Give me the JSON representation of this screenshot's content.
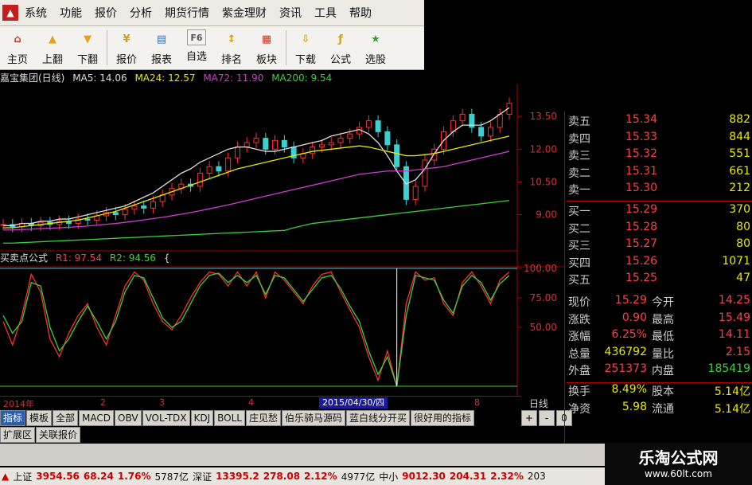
{
  "menu": {
    "items": [
      "系统",
      "功能",
      "报价",
      "分析",
      "期货行情",
      "紫金理财",
      "资讯",
      "工具",
      "帮助"
    ]
  },
  "toolbar": {
    "buttons": [
      {
        "label": "主页",
        "icon": "home-icon",
        "color": "#c0392b"
      },
      {
        "label": "上翻",
        "icon": "arrow-up-icon",
        "color": "#e8a21a"
      },
      {
        "label": "下翻",
        "icon": "arrow-down-icon",
        "color": "#e8a21a"
      },
      {
        "label": "报价",
        "icon": "yen-icon",
        "color": "#d4a017"
      },
      {
        "label": "报表",
        "icon": "report-icon",
        "color": "#3a6fb0"
      },
      {
        "label": "自选",
        "icon": "f6-icon",
        "color": "#7a7a7a"
      },
      {
        "label": "排名",
        "icon": "ranking-icon",
        "color": "#d4a017"
      },
      {
        "label": "板块",
        "icon": "blocks-icon",
        "color": "#c0392b"
      },
      {
        "label": "下载",
        "icon": "download-icon",
        "color": "#e8a21a"
      },
      {
        "label": "公式",
        "icon": "formula-icon",
        "color": "#d4a017"
      },
      {
        "label": "选股",
        "icon": "stock-picker-icon",
        "color": "#3a9a3a"
      }
    ]
  },
  "chart_header": {
    "title": "嘉宝集团(日线)",
    "ma5": "MA5: 14.06",
    "ma24": "MA24: 12.57",
    "ma72": "MA72: 11.90",
    "ma200": "MA200: 9.54"
  },
  "indicator_header": {
    "title": "买卖点公式",
    "r1": "R1: 97.54",
    "r2": "R2: 94.56",
    "cursor": "{"
  },
  "axis": {
    "price_ticks": [
      "13.50",
      "12.00",
      "10.50",
      "9.00"
    ],
    "indicator_ticks": [
      "100.00",
      "75.00",
      "50.00"
    ],
    "time_labels": [
      "2014年",
      "2",
      "3",
      "4",
      "8"
    ],
    "cursor_date": "2015/04/30/四",
    "chart_type": "日线"
  },
  "tabs": {
    "row1": [
      "指标",
      "模板",
      "全部",
      "MACD",
      "OBV",
      "VOL-TDX",
      "KDJ",
      "BOLL",
      "庄见愁",
      "伯乐骑马源码",
      "蓝白线分开买",
      "很好用的指标"
    ],
    "row2": [
      "扩展区",
      "关联报价"
    ],
    "nav": [
      "+",
      "-",
      "0"
    ]
  },
  "order_book": {
    "sell": [
      {
        "label": "卖五",
        "price": "15.34",
        "vol": "882"
      },
      {
        "label": "卖四",
        "price": "15.33",
        "vol": "844"
      },
      {
        "label": "卖三",
        "price": "15.32",
        "vol": "551"
      },
      {
        "label": "卖二",
        "price": "15.31",
        "vol": "661"
      },
      {
        "label": "卖一",
        "price": "15.30",
        "vol": "212"
      }
    ],
    "buy": [
      {
        "label": "买一",
        "price": "15.29",
        "vol": "370"
      },
      {
        "label": "买二",
        "price": "15.28",
        "vol": "80"
      },
      {
        "label": "买三",
        "price": "15.27",
        "vol": "80"
      },
      {
        "label": "买四",
        "price": "15.26",
        "vol": "1071"
      },
      {
        "label": "买五",
        "price": "15.25",
        "vol": "47"
      }
    ]
  },
  "stats": [
    {
      "l1": "现价",
      "v1": "15.29",
      "c1": "#ff4040",
      "l2": "今开",
      "v2": "14.25",
      "c2": "#ff4040"
    },
    {
      "l1": "涨跌",
      "v1": "0.90",
      "c1": "#ff4040",
      "l2": "最高",
      "v2": "15.49",
      "c2": "#ff4040"
    },
    {
      "l1": "涨幅",
      "v1": "6.25%",
      "c1": "#ff4040",
      "l2": "最低",
      "v2": "14.11",
      "c2": "#ff4040"
    },
    {
      "l1": "总量",
      "v1": "436792",
      "c1": "#e8e800",
      "l2": "量比",
      "v2": "2.15",
      "c2": "#ff4040"
    },
    {
      "l1": "外盘",
      "v1": "251373",
      "c1": "#ff4040",
      "l2": "内盘",
      "v2": "185419",
      "c2": "#3ad13a"
    }
  ],
  "stats2": [
    {
      "l1": "换手",
      "v1": "8.49%",
      "c1": "#e8e800",
      "l2": "股本",
      "v2": "5.14亿",
      "c2": "#e8e800"
    },
    {
      "l1": "净资",
      "v1": "5.98",
      "c1": "#e8e800",
      "l2": "流通",
      "v2": "5.14亿",
      "c2": "#e8e800"
    }
  ],
  "statusbar": {
    "sh_label": "上证",
    "sh_value": "3954.56",
    "sh_change": "68.24",
    "sh_pct": "1.76%",
    "sh_amount": "5787亿",
    "sz_label": "深证",
    "sz_value": "13395.2",
    "sz_change": "278.08",
    "sz_pct": "2.12%",
    "sz_amount": "4977亿",
    "zx_label": "中小",
    "zx_value": "9012.30",
    "zx_change": "204.31",
    "zx_pct": "2.32%",
    "zx_amount": "203"
  },
  "watermark": {
    "title": "乐淘公式网",
    "url": "www.60lt.com"
  },
  "chart_data": [
    {
      "type": "candlestick",
      "title": "嘉宝集团(日线)",
      "ylim": [
        8.0,
        14.2
      ],
      "y_ticks": [
        13.5,
        12.0,
        10.5,
        9.0
      ],
      "close": [
        8.55,
        8.45,
        8.6,
        8.5,
        8.65,
        8.55,
        8.7,
        8.6,
        8.8,
        8.75,
        8.95,
        9.1,
        9.0,
        9.25,
        9.4,
        9.3,
        9.6,
        9.9,
        10.2,
        10.4,
        10.3,
        10.9,
        11.2,
        11.0,
        11.6,
        12.1,
        12.3,
        12.5,
        12.0,
        12.4,
        12.1,
        11.6,
        11.8,
        12.1,
        12.2,
        12.3,
        12.5,
        12.7,
        13.0,
        13.3,
        12.8,
        12.2,
        11.2,
        9.7,
        10.3,
        11.5,
        12.0,
        12.8,
        13.3,
        13.6,
        13.0,
        12.6,
        13.0,
        13.6,
        14.1
      ],
      "series": [
        {
          "name": "MA5",
          "values": [
            8.5,
            8.5,
            8.6,
            8.6,
            8.7,
            8.7,
            8.8,
            8.8,
            8.9,
            9.0,
            9.1,
            9.2,
            9.3,
            9.4,
            9.6,
            9.8,
            10.0,
            10.3,
            10.6,
            10.9,
            11.1,
            11.4,
            11.6,
            11.8,
            12.0,
            12.1,
            12.1,
            12.0,
            11.9,
            11.9,
            12.0,
            12.1,
            12.2,
            12.3,
            12.4,
            12.6,
            12.7,
            12.8,
            12.9,
            12.7,
            12.3,
            11.7,
            11.0,
            10.4,
            10.6,
            11.1,
            11.8,
            12.4,
            12.8,
            13.1,
            13.1,
            13.1,
            13.3,
            13.6,
            13.9
          ]
        },
        {
          "name": "MA24",
          "values": [
            8.4,
            8.4,
            8.45,
            8.5,
            8.55,
            8.6,
            8.65,
            8.7,
            8.75,
            8.85,
            8.95,
            9.05,
            9.15,
            9.3,
            9.45,
            9.6,
            9.75,
            9.9,
            10.05,
            10.2,
            10.35,
            10.5,
            10.65,
            10.8,
            10.95,
            11.1,
            11.2,
            11.3,
            11.4,
            11.5,
            11.6,
            11.7,
            11.8,
            11.9,
            11.95,
            12.0,
            12.05,
            12.1,
            12.15,
            12.1,
            12.0,
            11.9,
            11.8,
            11.7,
            11.7,
            11.75,
            11.8,
            11.9,
            12.0,
            12.1,
            12.2,
            12.3,
            12.4,
            12.5,
            12.6
          ]
        },
        {
          "name": "MA72",
          "values": [
            8.3,
            8.3,
            8.32,
            8.34,
            8.36,
            8.38,
            8.4,
            8.42,
            8.45,
            8.48,
            8.52,
            8.56,
            8.6,
            8.65,
            8.7,
            8.76,
            8.82,
            8.88,
            8.95,
            9.02,
            9.1,
            9.18,
            9.27,
            9.36,
            9.45,
            9.55,
            9.65,
            9.75,
            9.85,
            9.95,
            10.05,
            10.15,
            10.25,
            10.35,
            10.45,
            10.55,
            10.65,
            10.75,
            10.85,
            10.9,
            10.95,
            11.0,
            11.0,
            11.0,
            11.05,
            11.1,
            11.15,
            11.2,
            11.3,
            11.4,
            11.5,
            11.6,
            11.7,
            11.8,
            11.9
          ]
        },
        {
          "name": "MA200",
          "values": [
            7.7,
            7.7,
            7.72,
            7.74,
            7.76,
            7.78,
            7.8,
            7.82,
            7.84,
            7.86,
            7.88,
            7.9,
            7.92,
            7.94,
            7.96,
            7.98,
            8.0,
            8.02,
            8.04,
            8.06,
            8.08,
            8.1,
            8.12,
            8.14,
            8.16,
            8.18,
            8.2,
            8.22,
            8.24,
            8.26,
            8.28,
            8.4,
            8.5,
            8.6,
            8.65,
            8.7,
            8.75,
            8.8,
            8.85,
            8.9,
            8.95,
            9.0,
            9.05,
            9.1,
            9.15,
            9.2,
            9.25,
            9.3,
            9.35,
            9.4,
            9.45,
            9.5,
            9.55,
            9.6,
            9.65
          ]
        }
      ]
    },
    {
      "type": "line",
      "title": "买卖点公式",
      "ylim": [
        0,
        100
      ],
      "y_ticks": [
        100,
        75,
        50
      ],
      "series": [
        {
          "name": "R1",
          "values": [
            55,
            35,
            60,
            95,
            80,
            40,
            25,
            45,
            60,
            70,
            50,
            35,
            60,
            85,
            97,
            90,
            70,
            55,
            48,
            60,
            75,
            88,
            97,
            95,
            85,
            97,
            85,
            97,
            75,
            97,
            90,
            80,
            70,
            85,
            95,
            97,
            80,
            65,
            50,
            25,
            5,
            30,
            0,
            70,
            97,
            90,
            92,
            70,
            60,
            88,
            97,
            85,
            70,
            90,
            97
          ]
        },
        {
          "name": "R2",
          "values": [
            60,
            45,
            55,
            88,
            85,
            50,
            30,
            40,
            55,
            68,
            55,
            40,
            55,
            80,
            94,
            92,
            75,
            58,
            50,
            55,
            70,
            85,
            94,
            96,
            88,
            94,
            88,
            94,
            78,
            94,
            92,
            82,
            72,
            82,
            92,
            94,
            83,
            68,
            55,
            30,
            10,
            25,
            0,
            60,
            94,
            92,
            90,
            73,
            62,
            85,
            94,
            88,
            73,
            87,
            94
          ]
        }
      ]
    }
  ]
}
